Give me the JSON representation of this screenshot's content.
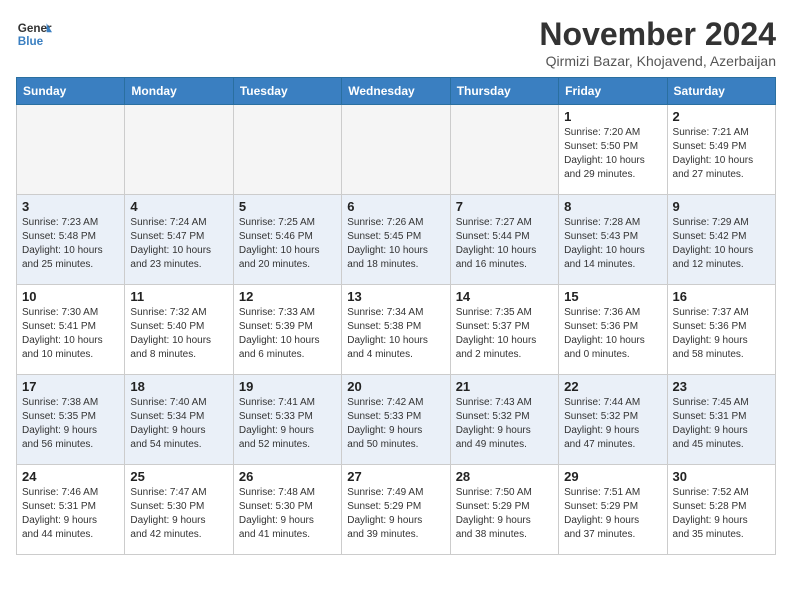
{
  "logo": {
    "name": "General Blue",
    "line1": "General",
    "line2": "Blue"
  },
  "title": "November 2024",
  "location": "Qirmizi Bazar, Khojavend, Azerbaijan",
  "weekdays": [
    "Sunday",
    "Monday",
    "Tuesday",
    "Wednesday",
    "Thursday",
    "Friday",
    "Saturday"
  ],
  "weeks": [
    [
      {
        "day": "",
        "info": ""
      },
      {
        "day": "",
        "info": ""
      },
      {
        "day": "",
        "info": ""
      },
      {
        "day": "",
        "info": ""
      },
      {
        "day": "",
        "info": ""
      },
      {
        "day": "1",
        "info": "Sunrise: 7:20 AM\nSunset: 5:50 PM\nDaylight: 10 hours\nand 29 minutes."
      },
      {
        "day": "2",
        "info": "Sunrise: 7:21 AM\nSunset: 5:49 PM\nDaylight: 10 hours\nand 27 minutes."
      }
    ],
    [
      {
        "day": "3",
        "info": "Sunrise: 7:23 AM\nSunset: 5:48 PM\nDaylight: 10 hours\nand 25 minutes."
      },
      {
        "day": "4",
        "info": "Sunrise: 7:24 AM\nSunset: 5:47 PM\nDaylight: 10 hours\nand 23 minutes."
      },
      {
        "day": "5",
        "info": "Sunrise: 7:25 AM\nSunset: 5:46 PM\nDaylight: 10 hours\nand 20 minutes."
      },
      {
        "day": "6",
        "info": "Sunrise: 7:26 AM\nSunset: 5:45 PM\nDaylight: 10 hours\nand 18 minutes."
      },
      {
        "day": "7",
        "info": "Sunrise: 7:27 AM\nSunset: 5:44 PM\nDaylight: 10 hours\nand 16 minutes."
      },
      {
        "day": "8",
        "info": "Sunrise: 7:28 AM\nSunset: 5:43 PM\nDaylight: 10 hours\nand 14 minutes."
      },
      {
        "day": "9",
        "info": "Sunrise: 7:29 AM\nSunset: 5:42 PM\nDaylight: 10 hours\nand 12 minutes."
      }
    ],
    [
      {
        "day": "10",
        "info": "Sunrise: 7:30 AM\nSunset: 5:41 PM\nDaylight: 10 hours\nand 10 minutes."
      },
      {
        "day": "11",
        "info": "Sunrise: 7:32 AM\nSunset: 5:40 PM\nDaylight: 10 hours\nand 8 minutes."
      },
      {
        "day": "12",
        "info": "Sunrise: 7:33 AM\nSunset: 5:39 PM\nDaylight: 10 hours\nand 6 minutes."
      },
      {
        "day": "13",
        "info": "Sunrise: 7:34 AM\nSunset: 5:38 PM\nDaylight: 10 hours\nand 4 minutes."
      },
      {
        "day": "14",
        "info": "Sunrise: 7:35 AM\nSunset: 5:37 PM\nDaylight: 10 hours\nand 2 minutes."
      },
      {
        "day": "15",
        "info": "Sunrise: 7:36 AM\nSunset: 5:36 PM\nDaylight: 10 hours\nand 0 minutes."
      },
      {
        "day": "16",
        "info": "Sunrise: 7:37 AM\nSunset: 5:36 PM\nDaylight: 9 hours\nand 58 minutes."
      }
    ],
    [
      {
        "day": "17",
        "info": "Sunrise: 7:38 AM\nSunset: 5:35 PM\nDaylight: 9 hours\nand 56 minutes."
      },
      {
        "day": "18",
        "info": "Sunrise: 7:40 AM\nSunset: 5:34 PM\nDaylight: 9 hours\nand 54 minutes."
      },
      {
        "day": "19",
        "info": "Sunrise: 7:41 AM\nSunset: 5:33 PM\nDaylight: 9 hours\nand 52 minutes."
      },
      {
        "day": "20",
        "info": "Sunrise: 7:42 AM\nSunset: 5:33 PM\nDaylight: 9 hours\nand 50 minutes."
      },
      {
        "day": "21",
        "info": "Sunrise: 7:43 AM\nSunset: 5:32 PM\nDaylight: 9 hours\nand 49 minutes."
      },
      {
        "day": "22",
        "info": "Sunrise: 7:44 AM\nSunset: 5:32 PM\nDaylight: 9 hours\nand 47 minutes."
      },
      {
        "day": "23",
        "info": "Sunrise: 7:45 AM\nSunset: 5:31 PM\nDaylight: 9 hours\nand 45 minutes."
      }
    ],
    [
      {
        "day": "24",
        "info": "Sunrise: 7:46 AM\nSunset: 5:31 PM\nDaylight: 9 hours\nand 44 minutes."
      },
      {
        "day": "25",
        "info": "Sunrise: 7:47 AM\nSunset: 5:30 PM\nDaylight: 9 hours\nand 42 minutes."
      },
      {
        "day": "26",
        "info": "Sunrise: 7:48 AM\nSunset: 5:30 PM\nDaylight: 9 hours\nand 41 minutes."
      },
      {
        "day": "27",
        "info": "Sunrise: 7:49 AM\nSunset: 5:29 PM\nDaylight: 9 hours\nand 39 minutes."
      },
      {
        "day": "28",
        "info": "Sunrise: 7:50 AM\nSunset: 5:29 PM\nDaylight: 9 hours\nand 38 minutes."
      },
      {
        "day": "29",
        "info": "Sunrise: 7:51 AM\nSunset: 5:29 PM\nDaylight: 9 hours\nand 37 minutes."
      },
      {
        "day": "30",
        "info": "Sunrise: 7:52 AM\nSunset: 5:28 PM\nDaylight: 9 hours\nand 35 minutes."
      }
    ]
  ]
}
